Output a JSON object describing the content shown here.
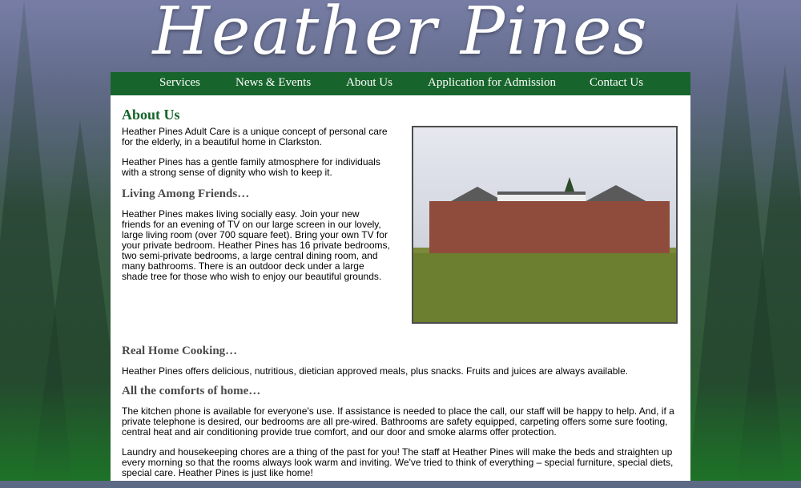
{
  "site": {
    "logo": "Heather Pines"
  },
  "nav": [
    {
      "label": "Services"
    },
    {
      "label": "News & Events"
    },
    {
      "label": "About Us"
    },
    {
      "label": "Application for Admission"
    },
    {
      "label": "Contact Us"
    }
  ],
  "page": {
    "title": "About Us",
    "intro1": "Heather Pines Adult Care is a unique concept of personal care for the elderly, in a beautiful home in Clarkston.",
    "intro2": "Heather Pines has a gentle family atmosphere for individuals with a strong sense of dignity who wish to keep it.",
    "friends_heading": "Living Among Friends…",
    "friends_text": "Heather Pines makes living socially easy. Join your new friends for an evening of TV on our large screen in our lovely, large living room (over 700 square feet). Bring your own TV for your private bedroom. Heather Pines has 16 private bedrooms, two semi-private bedrooms, a large central dining room, and many bathrooms. There is an outdoor deck under a large shade tree for those who wish to enjoy our beautiful grounds.",
    "cooking_heading": "Real Home Cooking…",
    "cooking_text": "Heather Pines offers delicious, nutritious, dietician approved meals, plus snacks. Fruits and juices are always available.",
    "comforts_heading": "All the comforts of home…",
    "comforts_text1": "The kitchen phone is available for everyone's use. If assistance is needed to place the call, our staff will be happy to help. And, if a private telephone is desired, our bedrooms are all pre-wired. Bathrooms are safety equipped, carpeting offers some sure footing, central heat and air conditioning provide true comfort, and our door and smoke alarms offer protection.",
    "comforts_text2": "Laundry and housekeeping chores are a thing of the past for you! The staff at Heather Pines will make the beds and straighten up every morning so that the rooms always look warm and inviting. We've tried to think of everything – special furniture, special diets, special care. Heather Pines is just like home!"
  },
  "colors": {
    "nav_bg": "#17652c",
    "heading_green": "#17652c",
    "subheading_gray": "#4a4a4a"
  }
}
